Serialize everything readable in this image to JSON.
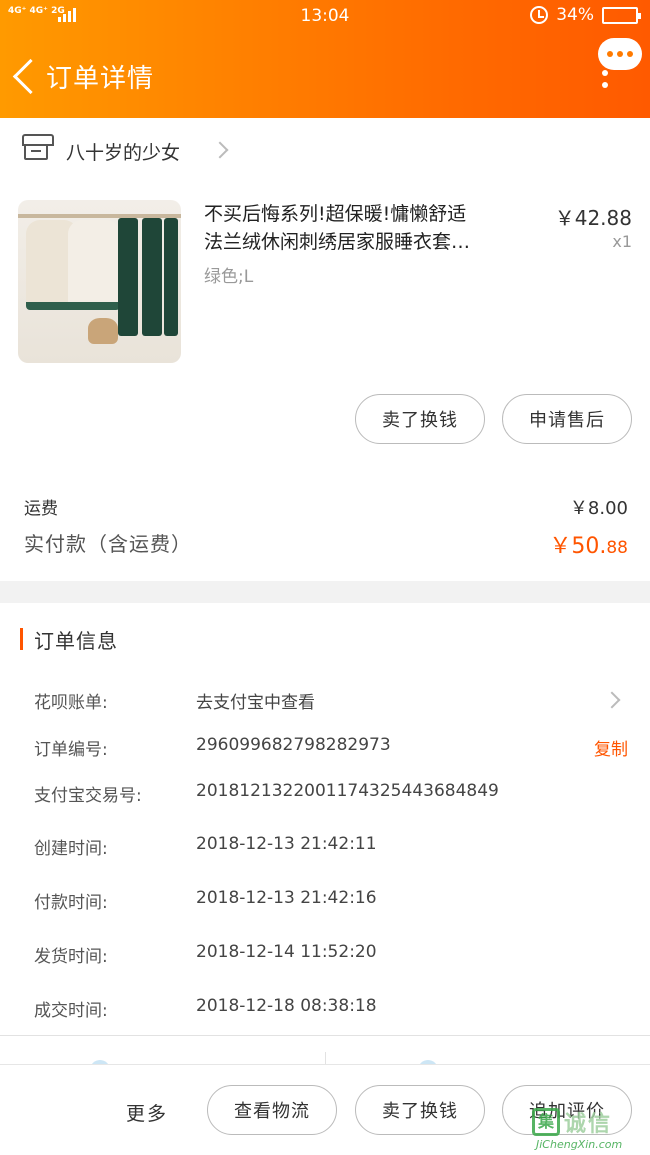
{
  "status_bar": {
    "network": "4G⁺ 4G⁺ 2G",
    "time": "13:04",
    "battery": "34%"
  },
  "header": {
    "title": "订单详情"
  },
  "shop": {
    "name": "八十岁的少女"
  },
  "product": {
    "title_line1": "不买后悔系列!超保暖!慵懒舒适",
    "title_line2": "法兰绒休闲刺绣居家服睡衣套…",
    "sku": "绿色;L",
    "price": "￥42.88",
    "quantity": "x1"
  },
  "actions": {
    "sell_label": "卖了换钱",
    "aftersale_label": "申请售后"
  },
  "fees": {
    "shipping_label": "运费",
    "shipping_value": "￥8.00",
    "paid_label": "实付款（含运费）",
    "paid_value_main": "￥50.",
    "paid_value_decimals": "88"
  },
  "order_info": {
    "section_title": "订单信息",
    "rows": [
      {
        "label": "花呗账单:",
        "value": "去支付宝中查看"
      },
      {
        "label": "订单编号:",
        "value": "296099682798282973",
        "action": "复制"
      },
      {
        "label": "支付宝交易号:",
        "value": "2018121322001174325443684849"
      },
      {
        "label": "创建时间:",
        "value": "2018-12-13 21:42:11"
      },
      {
        "label": "付款时间:",
        "value": "2018-12-13 21:42:16"
      },
      {
        "label": "发货时间:",
        "value": "2018-12-14 11:52:20"
      },
      {
        "label": "成交时间:",
        "value": "2018-12-18 08:38:18"
      }
    ]
  },
  "bottom_bar": {
    "more_label": "更多",
    "logistics_label": "查看物流",
    "sell_label": "卖了换钱",
    "review_label": "追加评价"
  },
  "watermark": {
    "box_char": "集",
    "cn": "诚信",
    "en": "JiChengXin.com"
  },
  "colors": {
    "header_start": "#ff9a00",
    "header_end": "#ff5a00",
    "accent": "#ff5500"
  }
}
